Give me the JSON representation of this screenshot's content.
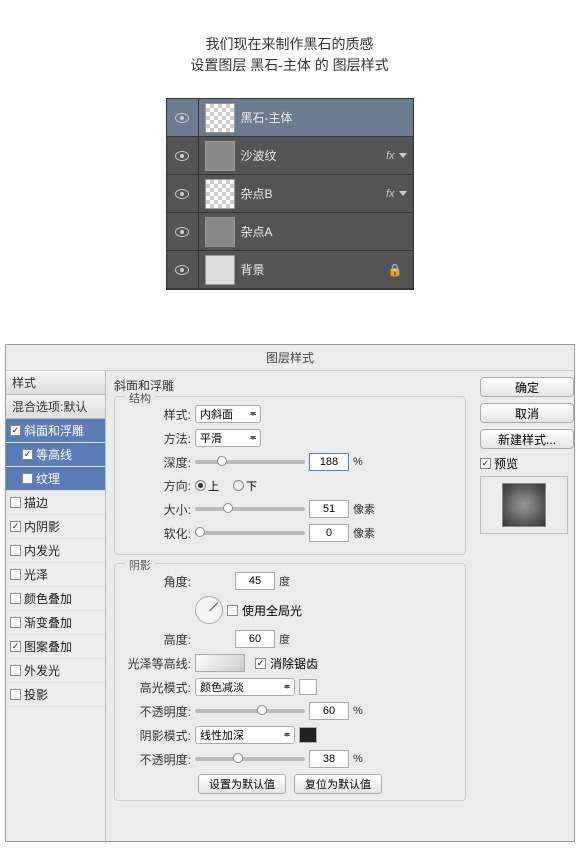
{
  "top": {
    "line1": "我们现在来制作黑石的质感",
    "line2": "设置图层 黑石-主体 的 图层样式"
  },
  "layers": [
    {
      "name": "黑石-主体",
      "selected": true,
      "fx": false,
      "lock": false,
      "thumb": "checker"
    },
    {
      "name": "沙波纹",
      "selected": false,
      "fx": true,
      "lock": false,
      "thumb": "gray"
    },
    {
      "name": "杂点B",
      "selected": false,
      "fx": true,
      "lock": false,
      "thumb": "checker"
    },
    {
      "name": "杂点A",
      "selected": false,
      "fx": false,
      "lock": false,
      "thumb": "gray"
    },
    {
      "name": "背景",
      "selected": false,
      "fx": false,
      "lock": true,
      "thumb": "lt"
    }
  ],
  "dialog": {
    "title": "图层样式",
    "sidebar": {
      "head1": "样式",
      "head2": "混合选项:默认",
      "items": [
        {
          "label": "斜面和浮雕",
          "checked": true,
          "sel": true,
          "sub": false
        },
        {
          "label": "等高线",
          "checked": true,
          "sel": true,
          "sub": true
        },
        {
          "label": "纹理",
          "checked": false,
          "sel": true,
          "sub": true
        },
        {
          "label": "描边",
          "checked": false,
          "sel": false,
          "sub": false
        },
        {
          "label": "内阴影",
          "checked": true,
          "sel": false,
          "sub": false
        },
        {
          "label": "内发光",
          "checked": false,
          "sel": false,
          "sub": false
        },
        {
          "label": "光泽",
          "checked": false,
          "sel": false,
          "sub": false
        },
        {
          "label": "颜色叠加",
          "checked": false,
          "sel": false,
          "sub": false
        },
        {
          "label": "渐变叠加",
          "checked": false,
          "sel": false,
          "sub": false
        },
        {
          "label": "图案叠加",
          "checked": true,
          "sel": false,
          "sub": false
        },
        {
          "label": "外发光",
          "checked": false,
          "sel": false,
          "sub": false
        },
        {
          "label": "投影",
          "checked": false,
          "sel": false,
          "sub": false
        }
      ]
    },
    "main": {
      "title": "斜面和浮雕",
      "struct_title": "结构",
      "style_label": "样式:",
      "style_val": "内斜面",
      "method_label": "方法:",
      "method_val": "平滑",
      "depth_label": "深度:",
      "depth_val": "188",
      "percent": "%",
      "dir_label": "方向:",
      "dir_up": "上",
      "dir_down": "下",
      "size_label": "大小:",
      "size_val": "51",
      "px": "像素",
      "soft_label": "软化:",
      "soft_val": "0",
      "shadow_title": "阴影",
      "angle_label": "角度:",
      "angle_val": "45",
      "deg": "度",
      "global_light": "使用全局光",
      "alt_label": "高度:",
      "alt_val": "60",
      "contour_label": "光泽等高线:",
      "antialias": "消除锯齿",
      "hl_mode_label": "高光模式:",
      "hl_mode_val": "颜色减淡",
      "hl_op_label": "不透明度:",
      "hl_op_val": "60",
      "sh_mode_label": "阴影模式:",
      "sh_mode_val": "线性加深",
      "sh_op_label": "不透明度:",
      "sh_op_val": "38",
      "btn_default": "设置为默认值",
      "btn_reset": "复位为默认值"
    },
    "right": {
      "ok": "确定",
      "cancel": "取消",
      "new_style": "新建样式...",
      "preview": "预览"
    }
  }
}
